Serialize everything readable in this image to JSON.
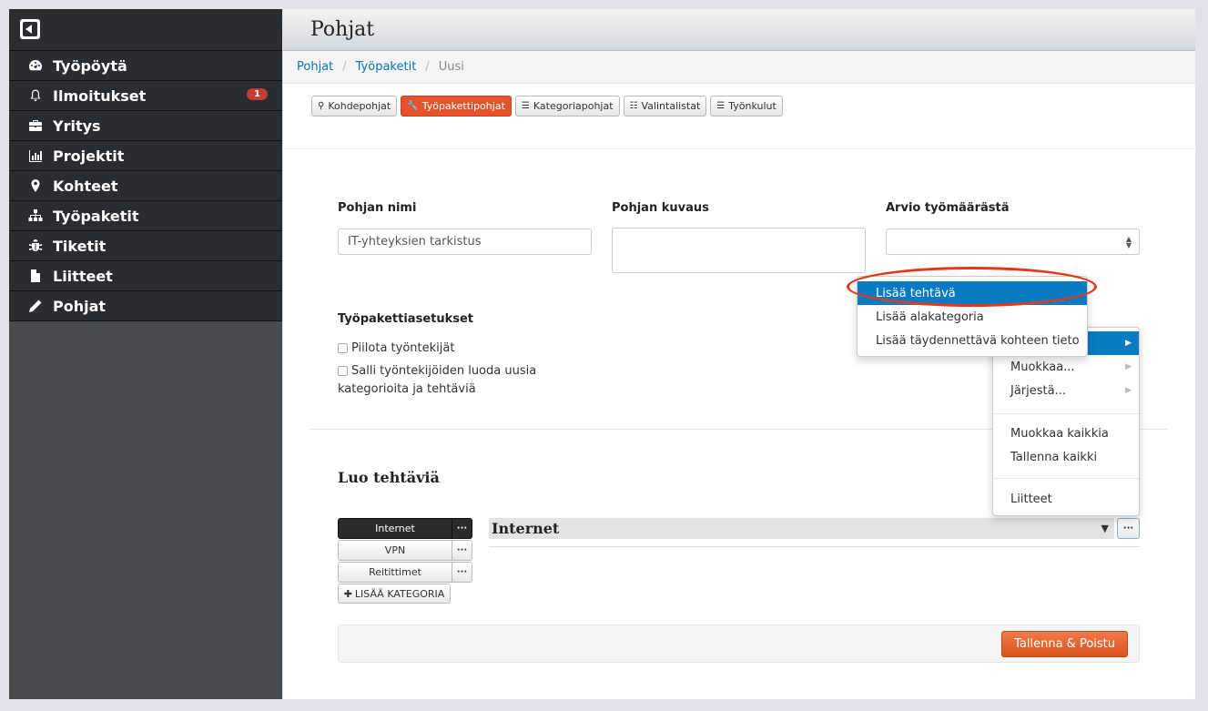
{
  "sidebar": {
    "items": [
      {
        "label": "Työpöytä",
        "icon": "dashboard-icon"
      },
      {
        "label": "Ilmoitukset",
        "icon": "bell-icon",
        "badge": "1"
      },
      {
        "label": "Yritys",
        "icon": "briefcase-icon"
      },
      {
        "label": "Projektit",
        "icon": "bar-chart-icon"
      },
      {
        "label": "Kohteet",
        "icon": "map-marker-icon"
      },
      {
        "label": "Työpaketit",
        "icon": "sitemap-icon"
      },
      {
        "label": "Tiketit",
        "icon": "bug-icon"
      },
      {
        "label": "Liitteet",
        "icon": "file-icon"
      },
      {
        "label": "Pohjat",
        "icon": "pencil-icon"
      }
    ]
  },
  "header": {
    "title": "Pohjat"
  },
  "breadcrumb": {
    "items": [
      "Pohjat",
      "Työpaketit"
    ],
    "current": "Uusi"
  },
  "template_tabs": [
    {
      "label": "Kohdepohjat",
      "icon": "map-marker-icon"
    },
    {
      "label": "Työpakettipohjat",
      "icon": "wrench-icon",
      "active": true
    },
    {
      "label": "Kategoriapohjat",
      "icon": "list-icon"
    },
    {
      "label": "Valintalistat",
      "icon": "list-ul-icon"
    },
    {
      "label": "Työnkulut",
      "icon": "tasks-icon"
    }
  ],
  "form": {
    "name_label": "Pohjan nimi",
    "name_value": "IT-yhteyksien tarkistus",
    "description_label": "Pohjan kuvaus",
    "description_value": "",
    "estimate_label": "Arvio työmäärästä",
    "estimate_value": "",
    "settings_label": "Työpakettiasetukset",
    "setting_hide": "Piilota työntekijät",
    "setting_allow": "Salli työntekijöiden luoda uusia kategorioita ja tehtäviä"
  },
  "tasks": {
    "title": "Luo tehtäviä",
    "categories": [
      "Internet",
      "VPN",
      "Reitittimet"
    ],
    "add_category": "LISÄÄ KATEGORIA",
    "selected_category": "Internet",
    "more_label": "···"
  },
  "menu_main": {
    "items": [
      "",
      "Muokkaa...",
      "Järjestä...",
      "Muokkaa kaikkia",
      "Tallenna kaikki",
      "Liitteet"
    ]
  },
  "menu_sub": {
    "items": [
      "Lisää tehtävä",
      "Lisää alakategoria",
      "Lisää täydennettävä kohteen tieto"
    ]
  },
  "footer": {
    "save_label": "Tallenna & Poistu"
  },
  "colors": {
    "accent": "#0a7bc2",
    "active_tab": "#e4532b",
    "badge": "#c43c35",
    "highlight": "#e2391b"
  }
}
